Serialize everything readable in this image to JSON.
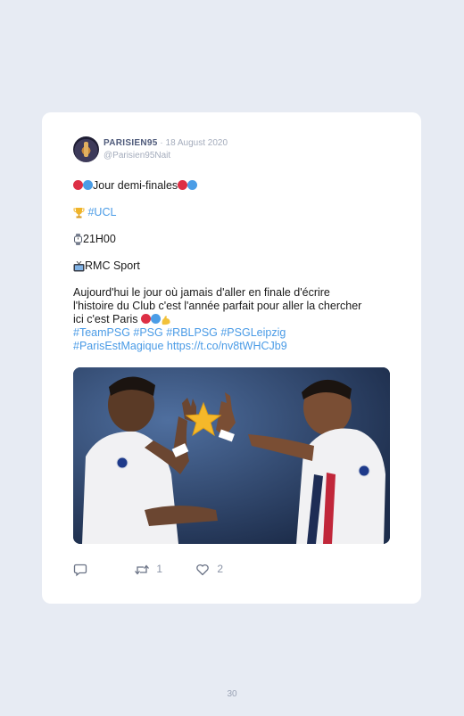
{
  "tweet": {
    "author_name": "PARISIEN95",
    "date": "· 18 August 2020",
    "handle": "@Parisien95Nait",
    "line1_text": "Jour demi-finales",
    "line2_link": "#UCL",
    "line3_text": "21H00",
    "line4_text": "RMC Sport",
    "para_line1": "Aujourd'hui le jour où jamais d'aller en finale d'écrire",
    "para_line2": "l'histoire du Club c'est l'année parfait pour aller la chercher",
    "para_line3": "ici c'est Paris",
    "hashtags_line1": "#TeamPSG #PSG #RBLPSG #PSGLeipzig",
    "hashtags_line2": "#ParisEstMagique https://t.co/nv8tWHCJb9",
    "retweet_count": "1",
    "like_count": "2"
  },
  "page_number": "30",
  "icons": {
    "reply": "reply-icon",
    "retweet": "retweet-icon",
    "like": "heart-icon",
    "trophy": "trophy-icon",
    "watch": "watch-icon",
    "tv": "tv-icon",
    "flex": "flexed-biceps-icon",
    "star": "star-icon"
  },
  "colors": {
    "background": "#e7ebf3",
    "card": "#ffffff",
    "link": "#4a9be6",
    "psg_red": "#dd2f45",
    "psg_blue": "#4b9de6"
  }
}
